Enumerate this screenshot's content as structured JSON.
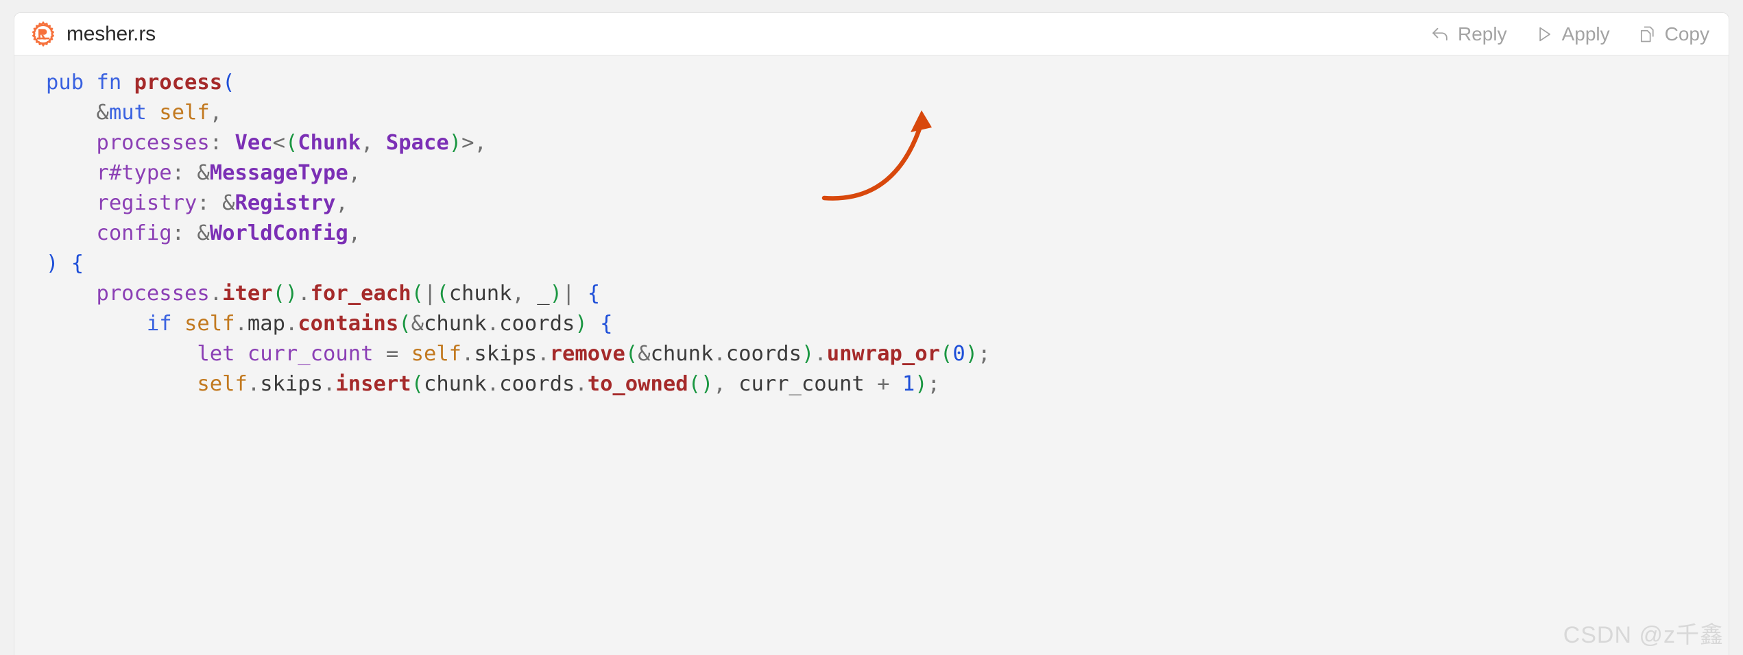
{
  "header": {
    "file_name": "mesher.rs",
    "icon": "rust-logo-icon",
    "actions": [
      {
        "label": "Reply",
        "icon": "reply-arrow-icon"
      },
      {
        "label": "Apply",
        "icon": "play-triangle-icon"
      },
      {
        "label": "Copy",
        "icon": "copy-pages-icon"
      }
    ]
  },
  "colors": {
    "accent_rust": "#F6713C",
    "page_background": "#f1f1f1",
    "card_background": "#f4f4f4",
    "header_background": "#ffffff",
    "action_text": "#a3a3a3",
    "annotation_arrow": "#d8480c",
    "watermark": "#d8d8d8",
    "keyword_blue": "#3a62e0",
    "function_red": "#a52a2a",
    "type_purple": "#7b2fb5",
    "identifier_purple": "#8b3fb5",
    "self_orange": "#c2791f",
    "paren_green": "#1a9641",
    "punctuation_gray": "#6e6e6e"
  },
  "code": {
    "language": "rust",
    "lines": [
      "pub fn process(",
      "    &mut self,",
      "    processes: Vec<(Chunk, Space)>,",
      "    r#type: &MessageType,",
      "    registry: &Registry,",
      "    config: &WorldConfig,",
      ") {",
      "    processes.iter().for_each(|(chunk, _)| {",
      "        if self.map.contains(&chunk.coords) {",
      "            let curr_count = self.skips.remove(&chunk.coords).unwrap_or(0);",
      "            self.skips.insert(chunk.coords.to_owned(), curr_count + 1);"
    ]
  },
  "annotation": {
    "type": "curved-arrow",
    "direction": "up-right",
    "color": "#d8480c"
  },
  "watermark": {
    "text": "CSDN @z千鑫"
  }
}
